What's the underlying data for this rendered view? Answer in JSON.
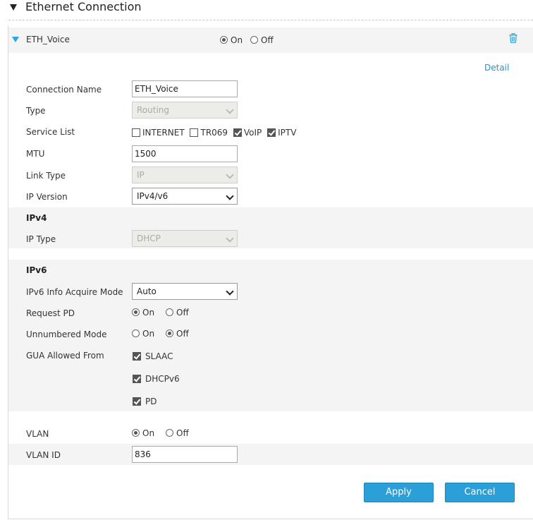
{
  "header": {
    "title": "Ethernet Connection"
  },
  "connection": {
    "name": "ETH_Voice",
    "state": {
      "on_label": "On",
      "off_label": "Off",
      "selected": "On"
    },
    "detail_link": "Detail"
  },
  "form": {
    "connection_name": {
      "label": "Connection Name",
      "value": "ETH_Voice"
    },
    "type": {
      "label": "Type",
      "value": "Routing",
      "disabled": true
    },
    "service_list": {
      "label": "Service List",
      "options": [
        {
          "label": "INTERNET",
          "checked": false
        },
        {
          "label": "TR069",
          "checked": false
        },
        {
          "label": "VoIP",
          "checked": true
        },
        {
          "label": "IPTV",
          "checked": true
        }
      ]
    },
    "mtu": {
      "label": "MTU",
      "value": "1500"
    },
    "link_type": {
      "label": "Link Type",
      "value": "IP",
      "disabled": true
    },
    "ip_version": {
      "label": "IP Version",
      "value": "IPv4/v6"
    },
    "ipv4": {
      "heading": "IPv4",
      "ip_type": {
        "label": "IP Type",
        "value": "DHCP",
        "disabled": true
      }
    },
    "ipv6": {
      "heading": "IPv6",
      "info_acquire_mode": {
        "label": "IPv6 Info Acquire Mode",
        "value": "Auto"
      },
      "request_pd": {
        "label": "Request PD",
        "on_label": "On",
        "off_label": "Off",
        "selected": "On"
      },
      "unnumbered_mode": {
        "label": "Unnumbered Mode",
        "on_label": "On",
        "off_label": "Off",
        "selected": "Off"
      },
      "gua_allowed_from": {
        "label": "GUA Allowed From",
        "options": [
          {
            "label": "SLAAC",
            "checked": true
          },
          {
            "label": "DHCPv6",
            "checked": true
          },
          {
            "label": "PD",
            "checked": true
          }
        ]
      }
    },
    "vlan": {
      "label": "VLAN",
      "on_label": "On",
      "off_label": "Off",
      "selected": "On"
    },
    "vlan_id": {
      "label": "VLAN ID",
      "value": "836"
    }
  },
  "buttons": {
    "apply": "Apply",
    "cancel": "Cancel"
  },
  "colors": {
    "accent": "#2a9fd8",
    "link": "#2a93c9",
    "band": "#f4f4f4"
  }
}
